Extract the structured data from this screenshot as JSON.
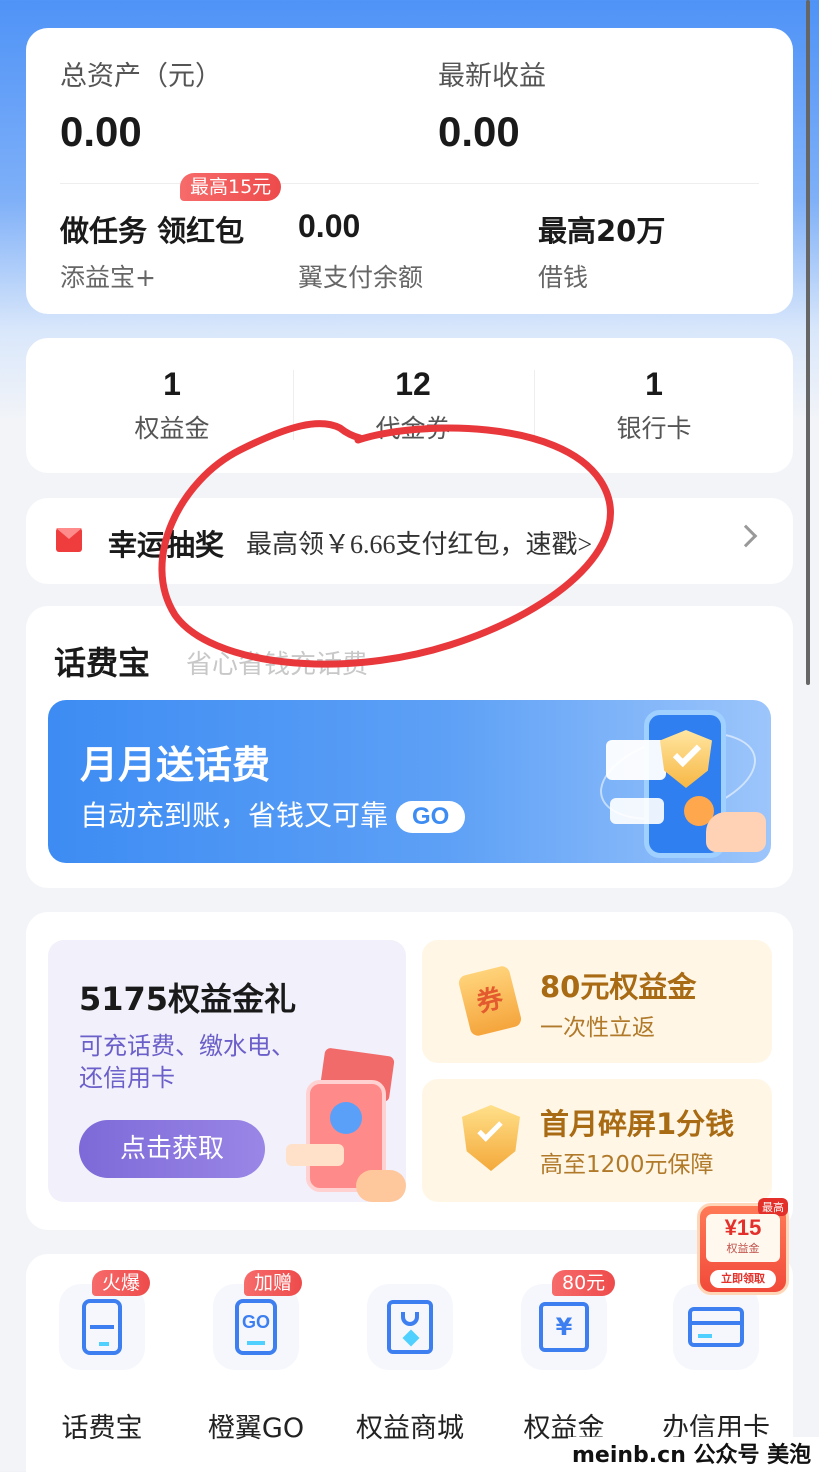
{
  "assets": {
    "total_label": "总资产（元）",
    "total_value": "0.00",
    "income_label": "最新收益",
    "income_value": "0.00",
    "task_title": "做任务 领红包",
    "task_sub": "添益宝+",
    "task_badge": "最高15元",
    "balance_value": "0.00",
    "balance_label": "翼支付余额",
    "loan_title": "最高20万",
    "loan_label": "借钱"
  },
  "stats": [
    {
      "value": "1",
      "label": "权益金"
    },
    {
      "value": "12",
      "label": "代金券"
    },
    {
      "value": "1",
      "label": "银行卡"
    }
  ],
  "lottery": {
    "title": "幸运抽奖",
    "desc": "最高领￥6.66支付红包，速戳>"
  },
  "phone_section": {
    "title": "话费宝",
    "subtitle": "省心省钱充话费",
    "banner_title": "月月送话费",
    "banner_sub": "自动充到账，省钱又可靠",
    "banner_go": "GO"
  },
  "benefits": {
    "gift_title": "5175权益金礼",
    "gift_line1": "可充话费、缴水电、",
    "gift_line2": "还信用卡",
    "gift_button": "点击获取",
    "coupon_icon_text": "券",
    "cash_title": "80元权益金",
    "cash_sub": "一次性立返",
    "screen_title": "首月碎屏1分钱",
    "screen_sub": "高至1200元保障"
  },
  "nav": [
    {
      "label": "话费宝",
      "badge": "火爆",
      "icon": "phone-icon"
    },
    {
      "label": "橙翼GO",
      "badge": "加赠",
      "icon": "go-icon"
    },
    {
      "label": "权益商城",
      "badge": "",
      "icon": "shopping-bag-icon"
    },
    {
      "label": "权益金",
      "badge": "80元",
      "icon": "yuan-gift-icon"
    },
    {
      "label": "办信用卡",
      "badge": "",
      "icon": "credit-card-icon"
    }
  ],
  "float_coupon": {
    "top": "最高",
    "amount": "¥15",
    "sub": "权益金",
    "action": "立即领取"
  },
  "watermark": "meinb.cn 公众号 美泡君",
  "colors": {
    "brand_blue": "#3d8cf3",
    "badge_red": "#ee4b4b",
    "annotation_red": "#e8383c",
    "gold_text": "#a86a12",
    "purple_button": "#8674dd"
  }
}
